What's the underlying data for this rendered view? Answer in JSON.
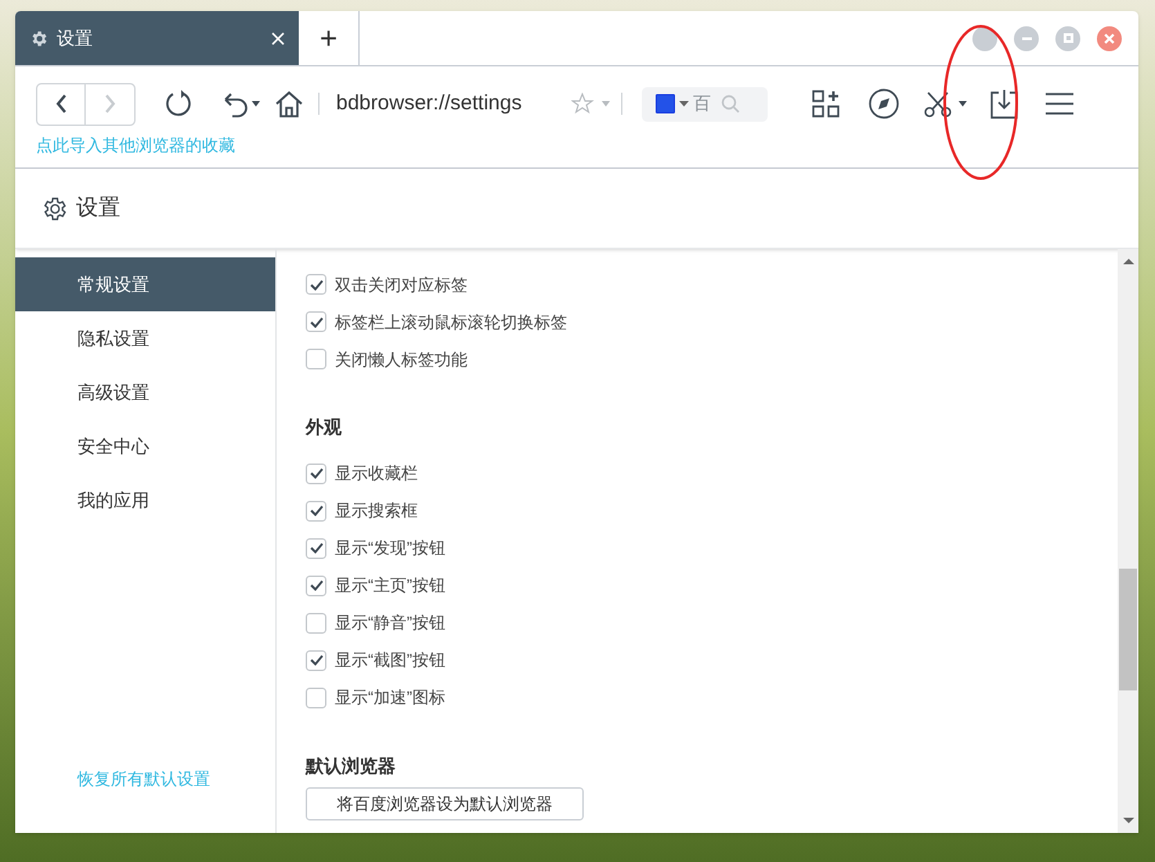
{
  "tabs": [
    {
      "label": "设置",
      "selected": true
    }
  ],
  "new_tab": "+",
  "address_bar": {
    "value": "bdbrowser://settings"
  },
  "search_box": {
    "text": "百"
  },
  "import_link": "点此导入其他浏览器的收藏",
  "page_title": "设置",
  "sidebar": {
    "items": [
      {
        "label": "常规设置",
        "selected": true
      },
      {
        "label": "隐私设置",
        "selected": false
      },
      {
        "label": "高级设置",
        "selected": false
      },
      {
        "label": "安全中心",
        "selected": false
      },
      {
        "label": "我的应用",
        "selected": false
      }
    ],
    "restore_link": "恢复所有默认设置"
  },
  "sections": [
    {
      "options": [
        {
          "label": "双击关闭对应标签",
          "checked": true
        },
        {
          "label": "标签栏上滚动鼠标滚轮切换标签",
          "checked": true
        },
        {
          "label": "关闭懒人标签功能",
          "checked": false
        }
      ]
    },
    {
      "title": "外观",
      "options": [
        {
          "label": "显示收藏栏",
          "checked": true
        },
        {
          "label": "显示搜索框",
          "checked": true
        },
        {
          "label": "显示“发现”按钮",
          "checked": true
        },
        {
          "label": "显示“主页”按钮",
          "checked": true
        },
        {
          "label": "显示“静音”按钮",
          "checked": false
        },
        {
          "label": "显示“截图”按钮",
          "checked": true
        },
        {
          "label": "显示“加速”图标",
          "checked": false
        }
      ]
    }
  ],
  "default_browser": {
    "title": "默认浏览器",
    "button": "将百度浏览器设为默认浏览器"
  }
}
